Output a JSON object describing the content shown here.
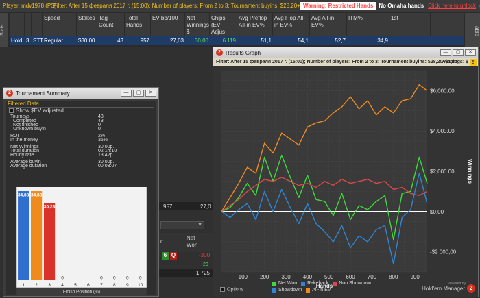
{
  "topbar": {
    "player": "Player: mdv1978 (PS)",
    "filter": "Filter: After 15 февраля 2017 г. (15:00); Number of players: From 2 to 3; Tournament buyins: $28,20+$1,80",
    "warning": "Warning: Restricted Hands",
    "no_omaha": "No Omaha hands",
    "unlock": "Click here to unlock",
    "close": "x"
  },
  "stats": {
    "side_label": "Stats",
    "table_label": "Table",
    "columns": [
      "",
      "",
      "",
      "Speed",
      "Stakes",
      "Tag Count",
      "Total Hands",
      "EV bb/100",
      "Net Winnings $",
      "Chips (EV Adjus",
      "Avg Preflop All-in EV%",
      "Avg Flop All-in EV%",
      "Avg All-in EV%",
      "ITM%",
      "1st"
    ],
    "row": [
      "Hold",
      "3",
      "STT",
      "Regular",
      "$30,00",
      "43",
      "957",
      "27,03",
      "30,00",
      "6 119",
      "51,1",
      "54,1",
      "52,7",
      "34,9",
      ""
    ]
  },
  "background": {
    "row_val1": "957",
    "row_val2": "27,0",
    "col_d": "d",
    "col_net": "Net",
    "col_won": "Won",
    "badge1": "6",
    "badge2": "Q",
    "neg": "-300",
    "twenty": "20",
    "total": "1 725"
  },
  "tourney": {
    "title": "Tournament Summary",
    "filtered": "Filtered Data",
    "show_sev": "Show $EV adjusted",
    "rows": [
      {
        "k": "Tourneys",
        "v": "43"
      },
      {
        "k": "Completed",
        "v": "43"
      },
      {
        "k": "Not finished",
        "v": "0"
      },
      {
        "k": "Unknown buyin",
        "v": "0"
      },
      {
        "k": "ROI",
        "v": "2%"
      },
      {
        "k": "In the money",
        "v": "35%"
      },
      {
        "k": "Net Winnings",
        "v": "30,00р."
      },
      {
        "k": "Total duration",
        "v": "02:14:10"
      },
      {
        "k": "Hourly rate",
        "v": "13,42р."
      },
      {
        "k": "Average buyin",
        "v": "30,00р."
      },
      {
        "k": "Average duration",
        "v": "00:03:07"
      }
    ],
    "chart_data": {
      "type": "bar",
      "categories": [
        "1",
        "2",
        "3",
        "4",
        "5",
        "6",
        "7",
        "8",
        "9",
        "10"
      ],
      "values": [
        34.88,
        34.88,
        30.23,
        0,
        0,
        0,
        0,
        0,
        0,
        0
      ],
      "labels": [
        "34,88",
        "34,88",
        "30,23",
        "0",
        "",
        "",
        "0",
        "0",
        "0",
        "0"
      ],
      "colors": [
        "#2f6fd0",
        "#ef8a1c",
        "#d8322b",
        "#2f6fd0",
        "#2f6fd0",
        "#2f6fd0",
        "#2f6fd0",
        "#2f6fd0",
        "#2f6fd0",
        "#2f6fd0"
      ],
      "xlabel": "Finish Position (%)",
      "ylim": [
        0,
        36
      ]
    }
  },
  "results": {
    "title": "Results Graph",
    "filter": "Filter: After 15 февраля 2017 г. (15:00); Number of players: From 2 to 3; Tournament buyins: $28,20+$1,80",
    "winnings_on": "Winnings: $",
    "warn_icon": "!",
    "options": "Options",
    "powered": "Powered by",
    "brand": "Hold'em Manager",
    "brand_num": "2",
    "chart_data": {
      "type": "line",
      "xlabel": "Hands",
      "ylabel": "Winnings",
      "xlim": [
        0,
        957
      ],
      "ylim": [
        -3000,
        7000
      ],
      "xticks": [
        100,
        200,
        300,
        400,
        500,
        600,
        700,
        800,
        900
      ],
      "yticks": [
        {
          "v": 6000,
          "label": "$6,000.00"
        },
        {
          "v": 4000,
          "label": "$4,000.00"
        },
        {
          "v": 2000,
          "label": "$2,000.00"
        },
        {
          "v": 0,
          "label": "$0,00"
        },
        {
          "v": -2000,
          "label": "-$2 000,00"
        }
      ],
      "series": [
        {
          "name": "Net Won",
          "color": "#3ddc3d",
          "x": [
            0,
            40,
            80,
            120,
            160,
            200,
            240,
            280,
            320,
            360,
            400,
            440,
            480,
            520,
            560,
            600,
            640,
            680,
            720,
            760,
            800,
            840,
            880,
            920,
            957
          ],
          "y": [
            0,
            200,
            700,
            1400,
            800,
            2700,
            1500,
            2800,
            1700,
            700,
            1800,
            600,
            500,
            -200,
            900,
            -400,
            300,
            100,
            500,
            800,
            -1400,
            900,
            1000,
            2700,
            1400
          ]
        },
        {
          "name": "Rakeback",
          "color": "#3a7fd8",
          "x": [
            0,
            957
          ],
          "y": [
            0,
            0
          ]
        },
        {
          "name": "Non Showdown",
          "color": "#d84a4a",
          "x": [
            0,
            40,
            80,
            120,
            160,
            200,
            240,
            280,
            320,
            360,
            400,
            440,
            480,
            520,
            560,
            600,
            640,
            680,
            720,
            760,
            800,
            840,
            880,
            920,
            957
          ],
          "y": [
            0,
            300,
            600,
            1000,
            1300,
            1600,
            1500,
            1700,
            1500,
            1300,
            1400,
            1200,
            1500,
            1300,
            1600,
            1400,
            1500,
            1600,
            1400,
            1500,
            1100,
            1200,
            900,
            800,
            1000
          ]
        },
        {
          "name": "Showdown",
          "color": "#2f86d6",
          "x": [
            0,
            40,
            80,
            120,
            160,
            200,
            240,
            280,
            320,
            360,
            400,
            440,
            480,
            520,
            560,
            600,
            640,
            680,
            720,
            760,
            800,
            840,
            880,
            920,
            957
          ],
          "y": [
            0,
            -300,
            100,
            400,
            -400,
            1000,
            0,
            1100,
            200,
            -600,
            400,
            -600,
            -1000,
            -1500,
            -700,
            -1800,
            -1200,
            -1500,
            -900,
            -700,
            -2600,
            -300,
            100,
            1900,
            400
          ]
        },
        {
          "name": "All-In EV",
          "color": "#ef8a1c",
          "x": [
            0,
            40,
            80,
            120,
            160,
            200,
            240,
            280,
            320,
            360,
            400,
            440,
            480,
            520,
            560,
            600,
            640,
            680,
            720,
            760,
            800,
            840,
            880,
            920,
            957
          ],
          "y": [
            0,
            700,
            1400,
            2200,
            1900,
            3400,
            2900,
            3900,
            3600,
            3300,
            4200,
            4400,
            4500,
            4900,
            5200,
            5700,
            5100,
            5500,
            4800,
            5200,
            4900,
            5500,
            5600,
            6300,
            6000
          ]
        }
      ]
    }
  }
}
